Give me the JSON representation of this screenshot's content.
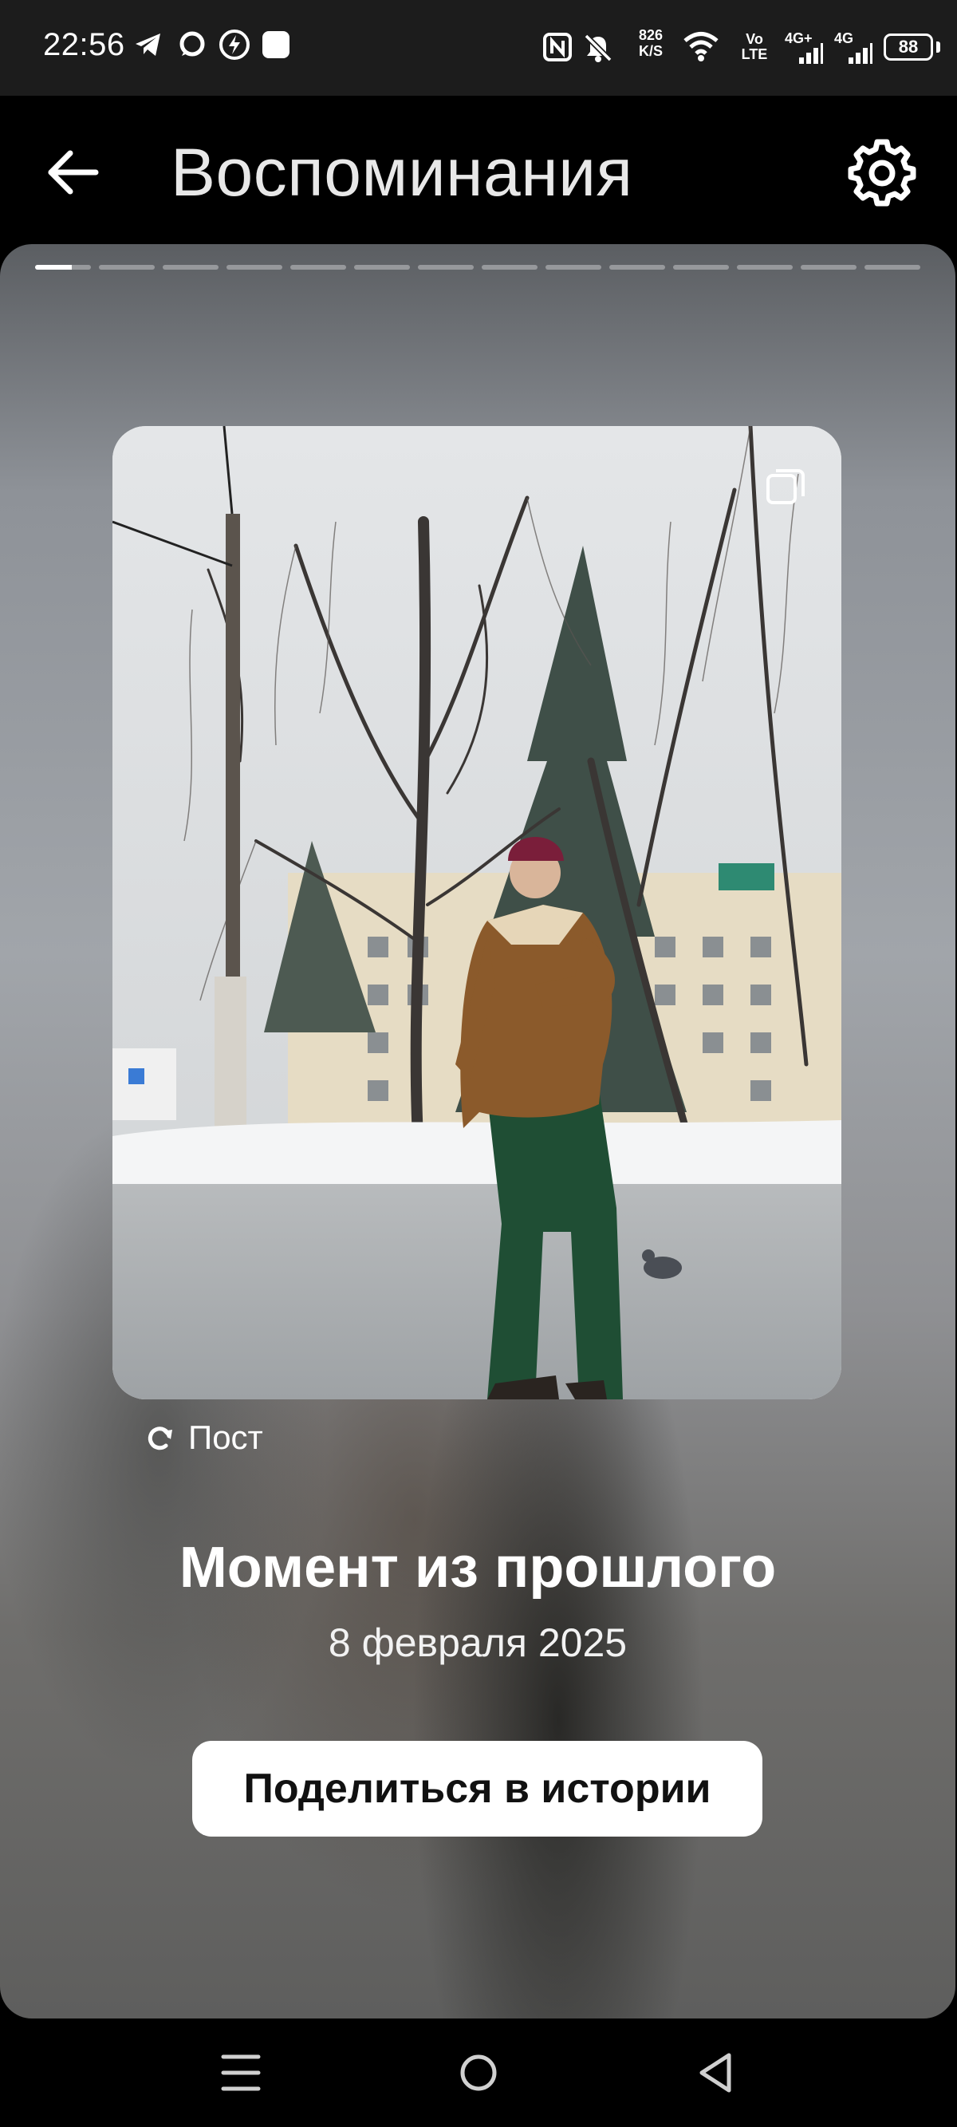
{
  "status_bar": {
    "time": "22:56",
    "speed_value": "826",
    "speed_unit": "K/S",
    "volte_top": "Vo",
    "volte_bottom": "LTE",
    "network_1": "4G+",
    "network_2": "4G",
    "battery": "88"
  },
  "header": {
    "title": "Воспоминания"
  },
  "memory": {
    "story_segments": 14,
    "active_segment": 0,
    "post_label": "Пост",
    "title": "Момент из прошлого",
    "date": "8 февраля 2025",
    "share_label": "Поделиться в истории"
  },
  "colors": {
    "status_bar_bg": "#1c1c1c",
    "header_bg": "#000000",
    "button_bg": "#ffffff"
  }
}
